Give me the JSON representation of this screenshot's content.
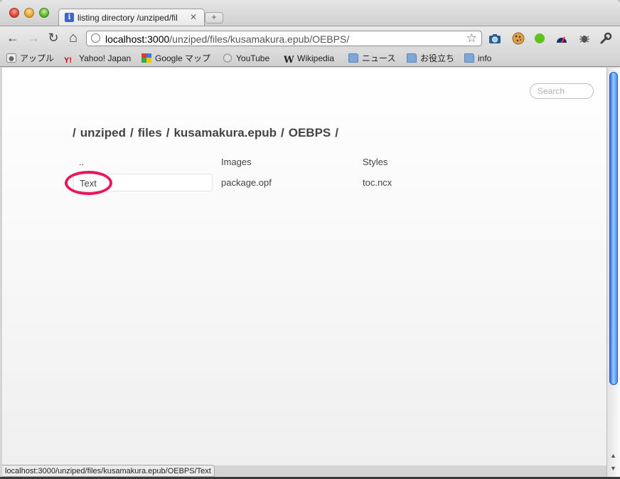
{
  "tab": {
    "title": "listing directory /unziped/fil",
    "close": "✕",
    "favicon_letter": "i"
  },
  "new_tab_symbol": "+",
  "toolbar": {
    "back": "←",
    "forward": "→",
    "reload": "↻",
    "home": "⌂",
    "url_host": "localhost:3000",
    "url_path": "/unziped/files/kusamakura.epub/OEBPS/",
    "star": "☆",
    "extensions": [
      "camera-icon",
      "cookie-icon",
      "green-dot-icon",
      "speed-icon",
      "bug-icon",
      "wrench-icon"
    ]
  },
  "bookmarks": [
    {
      "label": "アップル",
      "icon": "apple-icon"
    },
    {
      "label": "Yahoo! Japan",
      "icon": "yahoo-icon"
    },
    {
      "label": "Google マップ",
      "icon": "google-maps-icon"
    },
    {
      "label": "YouTube",
      "icon": "globe-icon"
    },
    {
      "label": "Wikipedia",
      "icon": "wikipedia-icon"
    },
    {
      "label": "ニュース",
      "icon": "folder-icon"
    },
    {
      "label": "お役立ち",
      "icon": "folder-icon"
    },
    {
      "label": "info",
      "icon": "folder-icon"
    }
  ],
  "page": {
    "search_placeholder": "Search",
    "breadcrumb": [
      "/",
      "unziped",
      "/",
      "files",
      "/",
      "kusamakura.epub",
      "/",
      "OEBPS",
      "/"
    ],
    "files": [
      "..",
      "Images",
      "Styles",
      "Text",
      "package.opf",
      "toc.ncx"
    ],
    "annotation_color": "#e8185a"
  },
  "status_bar": "localhost:3000/unziped/files/kusamakura.epub/OEBPS/Text"
}
